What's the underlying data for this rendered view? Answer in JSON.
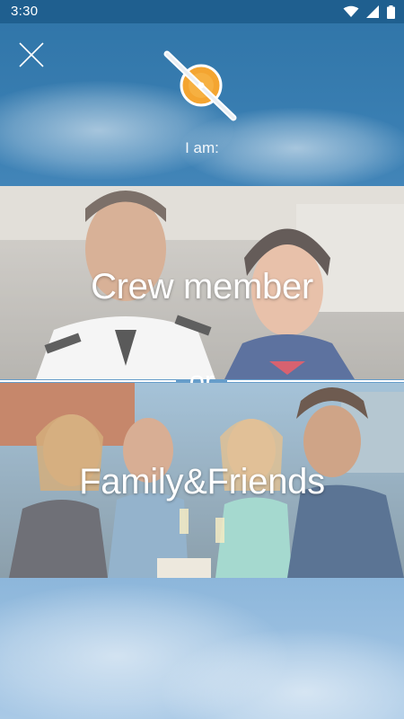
{
  "status_bar": {
    "time": "3:30",
    "icons": [
      "wifi-icon",
      "signal-icon",
      "battery-icon"
    ]
  },
  "header": {
    "close_icon": "close-icon",
    "logo_icon": "propeller-logo-icon",
    "prompt": "I am:"
  },
  "choices": {
    "crew": {
      "label": "Crew member"
    },
    "separator": "or",
    "family": {
      "label": "Family&Friends"
    }
  },
  "colors": {
    "sky_top": "#2f74a7",
    "sky_bottom": "#a9c9e6",
    "logo_orange": "#f4a531",
    "text": "#ffffff"
  }
}
